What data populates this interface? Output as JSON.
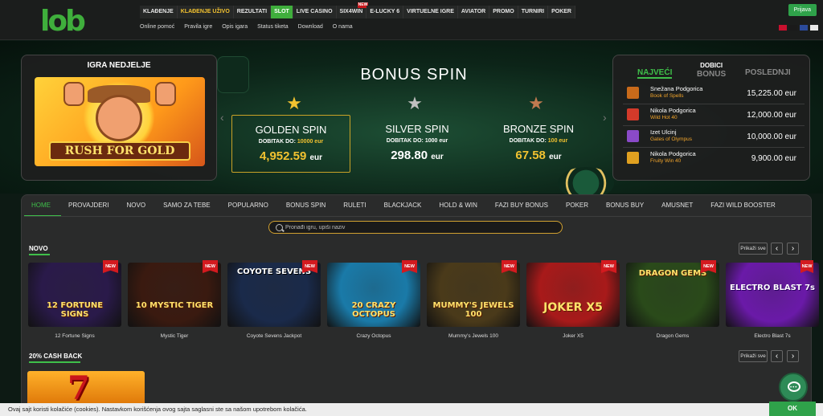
{
  "header": {
    "logo": "lob",
    "nav": [
      {
        "label": "KLAĐENJE",
        "state": "normal"
      },
      {
        "label": "KLAĐENJE UŽIVO",
        "state": "active"
      },
      {
        "label": "REZULTATI",
        "state": "normal"
      },
      {
        "label": "SLOT",
        "state": "selected"
      },
      {
        "label": "LIVE CASINO",
        "state": "normal"
      },
      {
        "label": "SIX4WIN",
        "state": "new"
      },
      {
        "label": "E-LUCKY 6",
        "state": "normal"
      },
      {
        "label": "VIRTUELNE IGRE",
        "state": "normal"
      },
      {
        "label": "AVIATOR",
        "state": "normal"
      },
      {
        "label": "PROMO",
        "state": "normal"
      },
      {
        "label": "TURNIRI",
        "state": "normal"
      },
      {
        "label": "POKER",
        "state": "normal"
      }
    ],
    "new_tag": "NEW",
    "subnav": [
      "Online pomoć",
      "Pravila igre",
      "Opis igara",
      "Status tiketa",
      "Download",
      "O nama"
    ],
    "login_label": "Prijava",
    "flags": [
      "#c8102e",
      "#1a1a1a",
      "#2b4a9a",
      "#e8e8e8"
    ]
  },
  "game_of_week": {
    "title": "IGRA NEDJELJE",
    "game_logo": "RUSH FOR GOLD"
  },
  "bonus_spin": {
    "title": "BONUS SPIN",
    "cards": [
      {
        "id": "golden",
        "name": "GOLDEN SPIN",
        "max_label": "DOBITAK DO:",
        "max_value": "10000 eur",
        "amount": "4,952.59",
        "currency": "eur",
        "star_color": "#f2c230"
      },
      {
        "id": "silver",
        "name": "SILVER SPIN",
        "max_label": "DOBITAK DO:",
        "max_value": "1000 eur",
        "amount": "298.80",
        "currency": "eur",
        "star_color": "#c0c0c0"
      },
      {
        "id": "bronze",
        "name": "BRONZE SPIN",
        "max_label": "DOBITAK DO:",
        "max_value": "100 eur",
        "amount": "67.58",
        "currency": "eur",
        "star_color": "#c07a50"
      }
    ],
    "prev_arrow": "‹",
    "next_arrow": "›"
  },
  "winners": {
    "tabs": {
      "left": "NAJVEĆI",
      "mid_top": "DOBICI",
      "mid": "BONUS",
      "right": "POSLEDNJI"
    },
    "rows": [
      {
        "name": "Snežana Podgorica",
        "game": "Book of Spells",
        "amount": "15,225.00 eur",
        "icon_color": "#c86a1a"
      },
      {
        "name": "Nikola Podgorica",
        "game": "Wild Hot 40",
        "amount": "12,000.00 eur",
        "icon_color": "#d33a2a"
      },
      {
        "name": "Izet Ulcinj",
        "game": "Gates of Olympus",
        "amount": "10,000.00 eur",
        "icon_color": "#8a4ac8"
      },
      {
        "name": "Nikola Podgorica",
        "game": "Fruity Win 40",
        "amount": "9,900.00 eur",
        "icon_color": "#e0a020"
      }
    ]
  },
  "categories": [
    "HOME",
    "PROVAJDERI",
    "NOVO",
    "SAMO ZA TEBE",
    "POPULARNO",
    "BONUS SPIN",
    "RULETI",
    "BLACKJACK",
    "HOLD & WIN",
    "FAZI BUY BONUS",
    "POKER",
    "BONUS BUY",
    "AMUSNET",
    "FAZI WILD BOOSTER"
  ],
  "search": {
    "placeholder": "Pronađi igru, upiši naziv"
  },
  "sections": {
    "novo_title": "NOVO",
    "cash_title": "20% CASH BACK",
    "show_all": "Prikaži sve",
    "prev": "‹",
    "next": "›"
  },
  "games": [
    {
      "name": "12 Fortune Signs",
      "art_text": "12 FORTUNE SIGNS",
      "badge": "NEW",
      "bg": "#2a1a4a"
    },
    {
      "name": "Mystic Tiger",
      "art_text": "10 MYSTIC TIGER",
      "badge": "NEW",
      "bg": "#3a1a10"
    },
    {
      "name": "Coyote Sevens Jackpot",
      "art_text": "COYOTE SEVENS",
      "badge": "NEW",
      "bg": "#1a2a4a"
    },
    {
      "name": "Crazy Octopus",
      "art_text": "20 CRAZY OCTOPUS",
      "badge": "NEW",
      "bg": "#1a7aa8"
    },
    {
      "name": "Mummy's Jewels 100",
      "art_text": "MUMMY'S JEWELS 100",
      "badge": "NEW",
      "bg": "#4a3a1a"
    },
    {
      "name": "Joker X5",
      "art_text": "JOKER X5",
      "badge": "NEW",
      "bg": "#a81a1a"
    },
    {
      "name": "Dragon Gems",
      "art_text": "DRAGON GEMS",
      "badge": "NEW",
      "bg": "#2a4a1a"
    },
    {
      "name": "Electro Blast 7s",
      "art_text": "ELECTRO BLAST 7s",
      "badge": "NEW",
      "bg": "#6a1aa8"
    }
  ],
  "cookie": {
    "text": "Ovaj sajt koristi kolačiće (cookies). Nastavkom korišćenja ovog sajta saglasni ste sa našom upotrebom kolačića.",
    "ok_label": "OK"
  },
  "colors": {
    "brand_green": "#3fae3c",
    "accent_gold": "#f2c230",
    "new_red": "#d31a1f"
  }
}
